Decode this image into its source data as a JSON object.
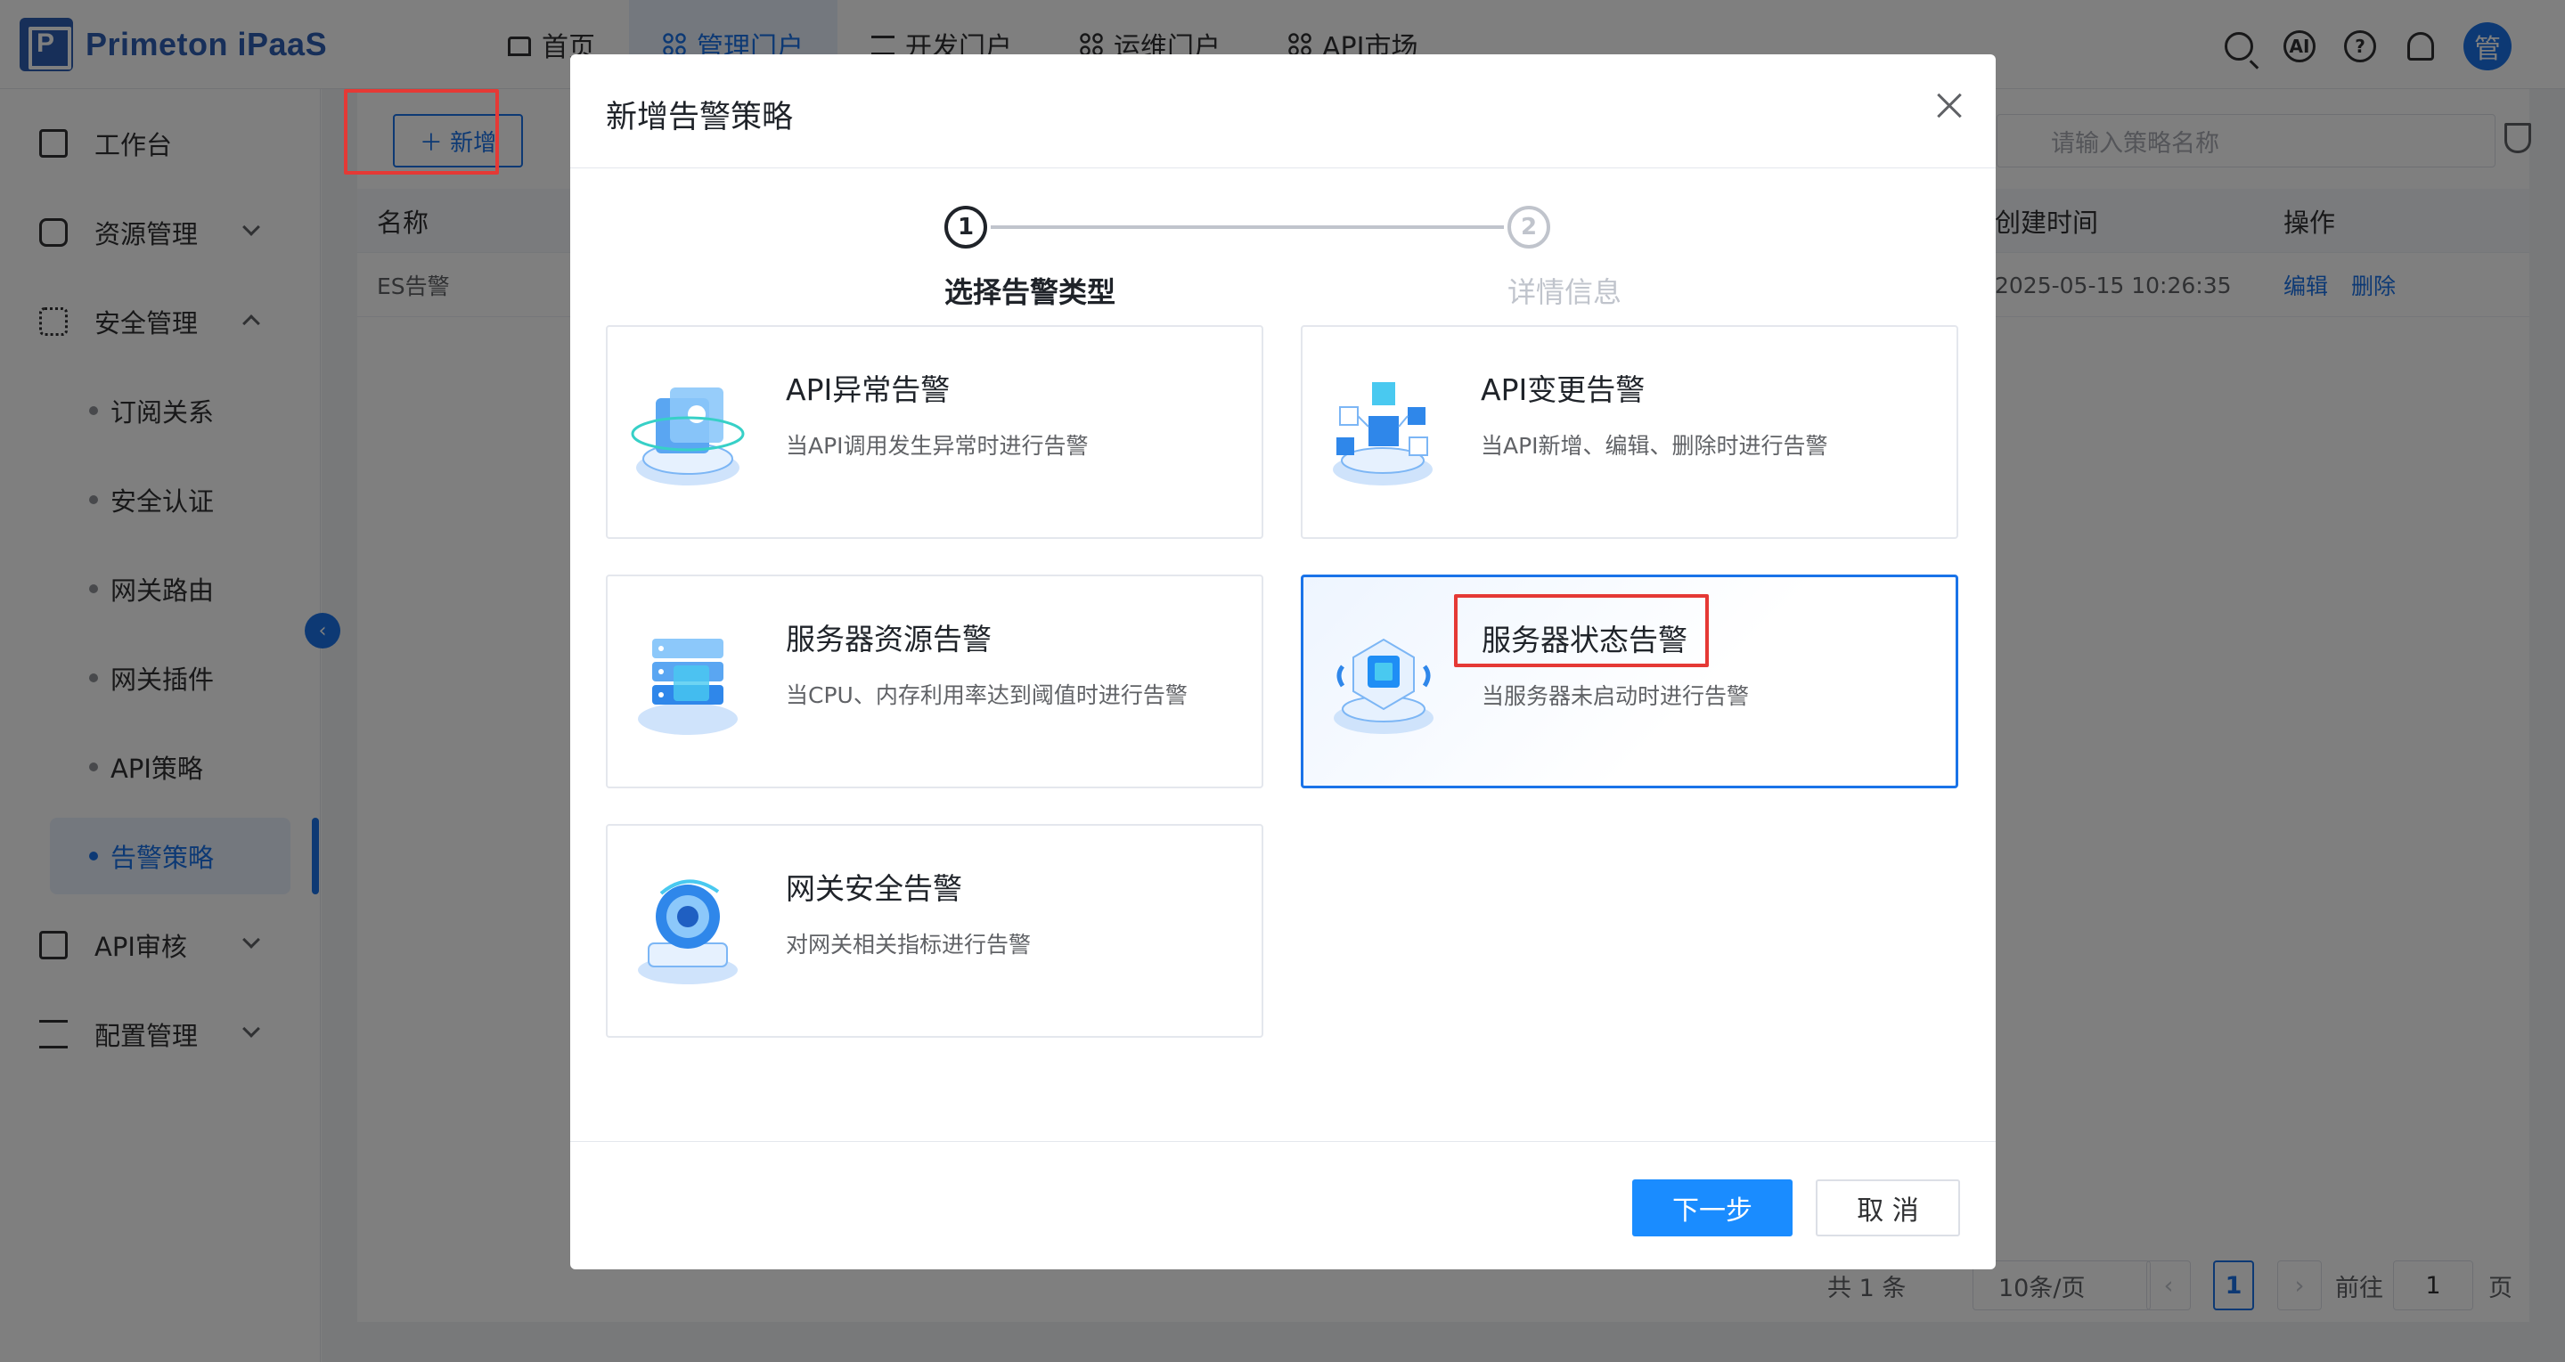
{
  "header": {
    "logo_text": "Primeton iPaaS",
    "nav": [
      {
        "label": "首页",
        "icon": "home-icon"
      },
      {
        "label": "管理门户",
        "icon": "apps-icon",
        "active": true
      },
      {
        "label": "开发门户",
        "icon": "layers-icon"
      },
      {
        "label": "运维门户",
        "icon": "apps-icon"
      },
      {
        "label": "API市场",
        "icon": "apps-icon"
      }
    ],
    "ai_label": "AI",
    "help_label": "?",
    "avatar_label": "管"
  },
  "sidebar": {
    "items": [
      {
        "label": "工作台",
        "icon": "home-icon"
      },
      {
        "label": "资源管理",
        "icon": "database-icon",
        "expandable": true
      },
      {
        "label": "安全管理",
        "icon": "apps-icon",
        "expanded": true
      }
    ],
    "sub_items": [
      "订阅关系",
      "安全认证",
      "网关路由",
      "网关插件",
      "API策略",
      "告警策略"
    ],
    "active_sub": "告警策略",
    "items_after": [
      {
        "label": "API审核",
        "icon": "document-icon"
      },
      {
        "label": "配置管理",
        "icon": "org-tree-icon"
      }
    ],
    "collapse_glyph": "‹"
  },
  "main": {
    "add_button": "＋ 新增",
    "search_placeholder": "请输入策略名称",
    "table": {
      "headers": [
        "名称",
        "创建时间",
        "操作"
      ],
      "rows": [
        {
          "name": "ES告警",
          "created": "2025-05-15 10:26:35",
          "actions": [
            "编辑",
            "删除"
          ]
        }
      ]
    },
    "pagination": {
      "total": "共 1 条",
      "page_size": "10条/页",
      "current": "1",
      "goto_label": "前往",
      "goto_value": "1",
      "page_suffix": "页",
      "prev": "‹",
      "next": "›"
    }
  },
  "modal": {
    "title": "新增告警策略",
    "steps": [
      {
        "num": "1",
        "label": "选择告警类型",
        "status": "current"
      },
      {
        "num": "2",
        "label": "详情信息",
        "status": "pending"
      }
    ],
    "cards": [
      {
        "title": "API异常告警",
        "desc": "当API调用发生异常时进行告警",
        "icon": "api-exception-icon"
      },
      {
        "title": "API变更告警",
        "desc": "当API新增、编辑、删除时进行告警",
        "icon": "api-change-icon"
      },
      {
        "title": "服务器资源告警",
        "desc": "当CPU、内存利用率达到阈值时进行告警",
        "icon": "server-resource-icon"
      },
      {
        "title": "服务器状态告警",
        "desc": "当服务器未启动时进行告警",
        "icon": "server-status-icon",
        "selected": true
      },
      {
        "title": "网关安全告警",
        "desc": "对网关相关指标进行告警",
        "icon": "gateway-security-icon"
      }
    ],
    "next_button": "下一步",
    "cancel_button": "取 消"
  },
  "colors": {
    "primary": "#1a73e8",
    "button_primary": "#1a8cff",
    "highlight_border": "#e53935"
  }
}
